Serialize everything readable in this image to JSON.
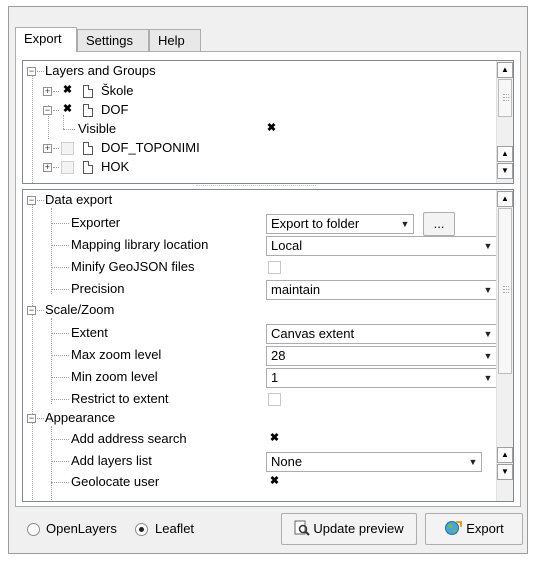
{
  "tabs": [
    {
      "label": "Export",
      "active": true
    },
    {
      "label": "Settings",
      "active": false
    },
    {
      "label": "Help",
      "active": false
    }
  ],
  "layers_tree": {
    "group_label": "Layers and Groups",
    "items": [
      {
        "name": "Škole",
        "checked": true,
        "expanded": false
      },
      {
        "name": "DOF",
        "checked": true,
        "expanded": true,
        "child": {
          "label": "Visible",
          "checked": true
        }
      },
      {
        "name": "DOF_TOPONIMI",
        "checked": false,
        "expanded": false
      },
      {
        "name": "HOK",
        "checked": false,
        "expanded": false
      }
    ]
  },
  "settings_tree": {
    "data_export": {
      "label": "Data export",
      "exporter": {
        "label": "Exporter",
        "value": "Export to folder",
        "browse_label": "..."
      },
      "mapping_library": {
        "label": "Mapping library location",
        "value": "Local"
      },
      "minify": {
        "label": "Minify GeoJSON files",
        "checked": false
      },
      "precision": {
        "label": "Precision",
        "value": "maintain"
      }
    },
    "scale_zoom": {
      "label": "Scale/Zoom",
      "extent": {
        "label": "Extent",
        "value": "Canvas extent"
      },
      "max_zoom": {
        "label": "Max zoom level",
        "value": "28"
      },
      "min_zoom": {
        "label": "Min zoom level",
        "value": "1"
      },
      "restrict": {
        "label": "Restrict to extent",
        "checked": false
      }
    },
    "appearance": {
      "label": "Appearance",
      "address_search": {
        "label": "Add address search",
        "checked": true
      },
      "layers_list": {
        "label": "Add layers list",
        "value": "None"
      },
      "geolocate": {
        "label": "Geolocate user",
        "checked": true
      }
    }
  },
  "bottom": {
    "radio_openlayers": "OpenLayers",
    "radio_leaflet": "Leaflet",
    "selected_library": "Leaflet",
    "update_preview_label": "Update preview",
    "export_label": "Export"
  },
  "icons": {
    "check_mark": "✖",
    "expand_plus": "+",
    "collapse_minus": "−",
    "dropdown_arrow": "▼",
    "scroll_up": "▲",
    "scroll_down": "▼"
  },
  "colors": {
    "window_bg": "#f0f0f0",
    "panel_bg": "#ffffff",
    "border": "#adadad"
  }
}
